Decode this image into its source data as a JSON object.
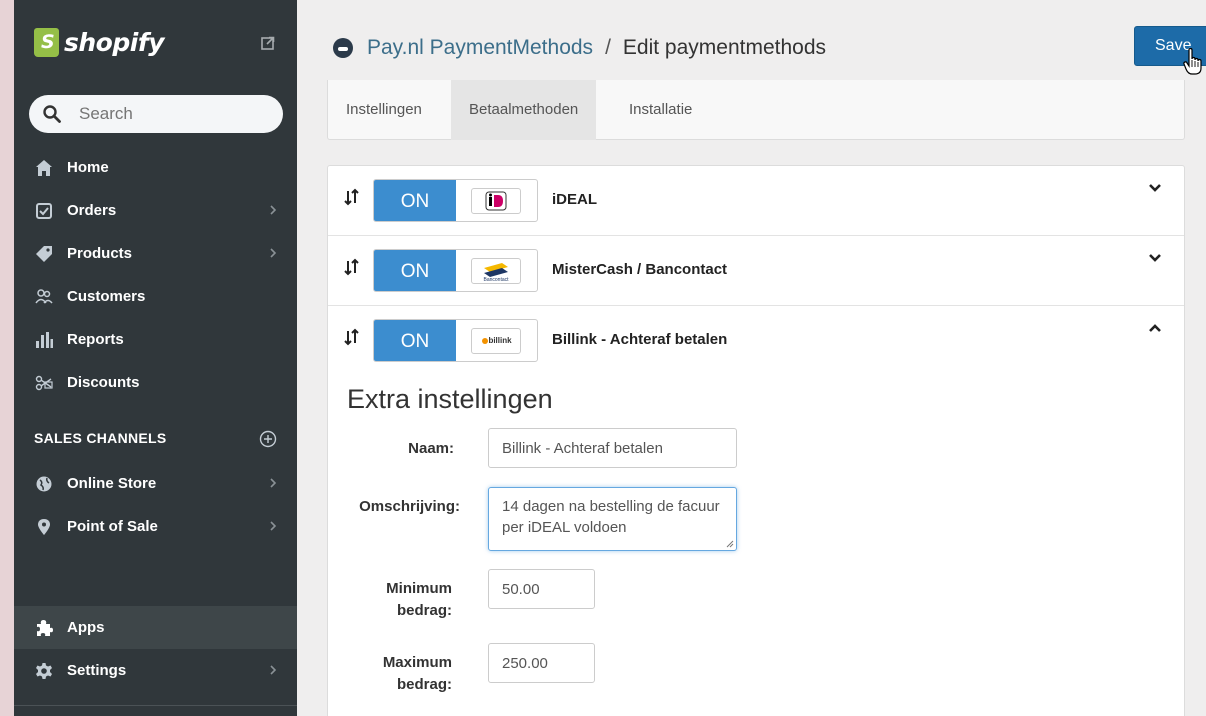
{
  "colors": {
    "sidebar_bg": "#30373b",
    "sidebar_active_bg": "#3e4649",
    "shopify_green": "#95bf47",
    "toggle_on": "#3c8dcf",
    "save_button": "#1d6ba8",
    "link": "#3c6e8a"
  },
  "sidebar": {
    "logo_text": "shopify",
    "logo_glyph": "S",
    "external_icon": "external-link-icon",
    "search": {
      "placeholder": "Search",
      "icon": "search-icon"
    },
    "items": [
      {
        "label": "Home",
        "icon": "home-icon",
        "has_chevron": false
      },
      {
        "label": "Orders",
        "icon": "orders-icon",
        "has_chevron": true
      },
      {
        "label": "Products",
        "icon": "tag-icon",
        "has_chevron": true
      },
      {
        "label": "Customers",
        "icon": "customers-icon",
        "has_chevron": false
      },
      {
        "label": "Reports",
        "icon": "bar-chart-icon",
        "has_chevron": false
      },
      {
        "label": "Discounts",
        "icon": "discount-icon",
        "has_chevron": false
      }
    ],
    "sales_channels_heading": "SALES CHANNELS",
    "channels": [
      {
        "label": "Online Store",
        "icon": "globe-icon",
        "has_chevron": true
      },
      {
        "label": "Point of Sale",
        "icon": "location-pin-icon",
        "has_chevron": true
      }
    ],
    "bottom": [
      {
        "label": "Apps",
        "icon": "puzzle-icon",
        "active": true,
        "has_chevron": false
      },
      {
        "label": "Settings",
        "icon": "gear-icon",
        "has_chevron": true
      }
    ]
  },
  "header": {
    "app_name": "Pay.nl PaymentMethods",
    "separator": "/",
    "page_title": "Edit paymentmethods",
    "save_label": "Save"
  },
  "tabs": [
    {
      "label": "Instellingen",
      "active": false
    },
    {
      "label": "Betaalmethoden",
      "active": true
    },
    {
      "label": "Installatie",
      "active": false
    }
  ],
  "methods": [
    {
      "name": "iDEAL",
      "toggle": "ON",
      "logo": "ideal-logo",
      "expanded": false
    },
    {
      "name": "MisterCash / Bancontact",
      "toggle": "ON",
      "logo": "bancontact-logo",
      "logo_caption": "Bancontact",
      "expanded": false
    },
    {
      "name": "Billink - Achteraf betalen",
      "toggle": "ON",
      "logo": "billink-logo",
      "logo_caption": "billink",
      "expanded": true
    }
  ],
  "extra": {
    "title": "Extra instellingen",
    "naam_label": "Naam:",
    "naam_value": "Billink - Achteraf betalen",
    "omschrijving_label": "Omschrijving:",
    "omschrijving_value": "14 dagen na bestelling de facuur per iDEAL voldoen",
    "min_label_1": "Minimum",
    "min_label_2": "bedrag:",
    "min_value": "50.00",
    "max_label_1": "Maximum",
    "max_label_2": "bedrag:",
    "max_value": "250.00"
  }
}
